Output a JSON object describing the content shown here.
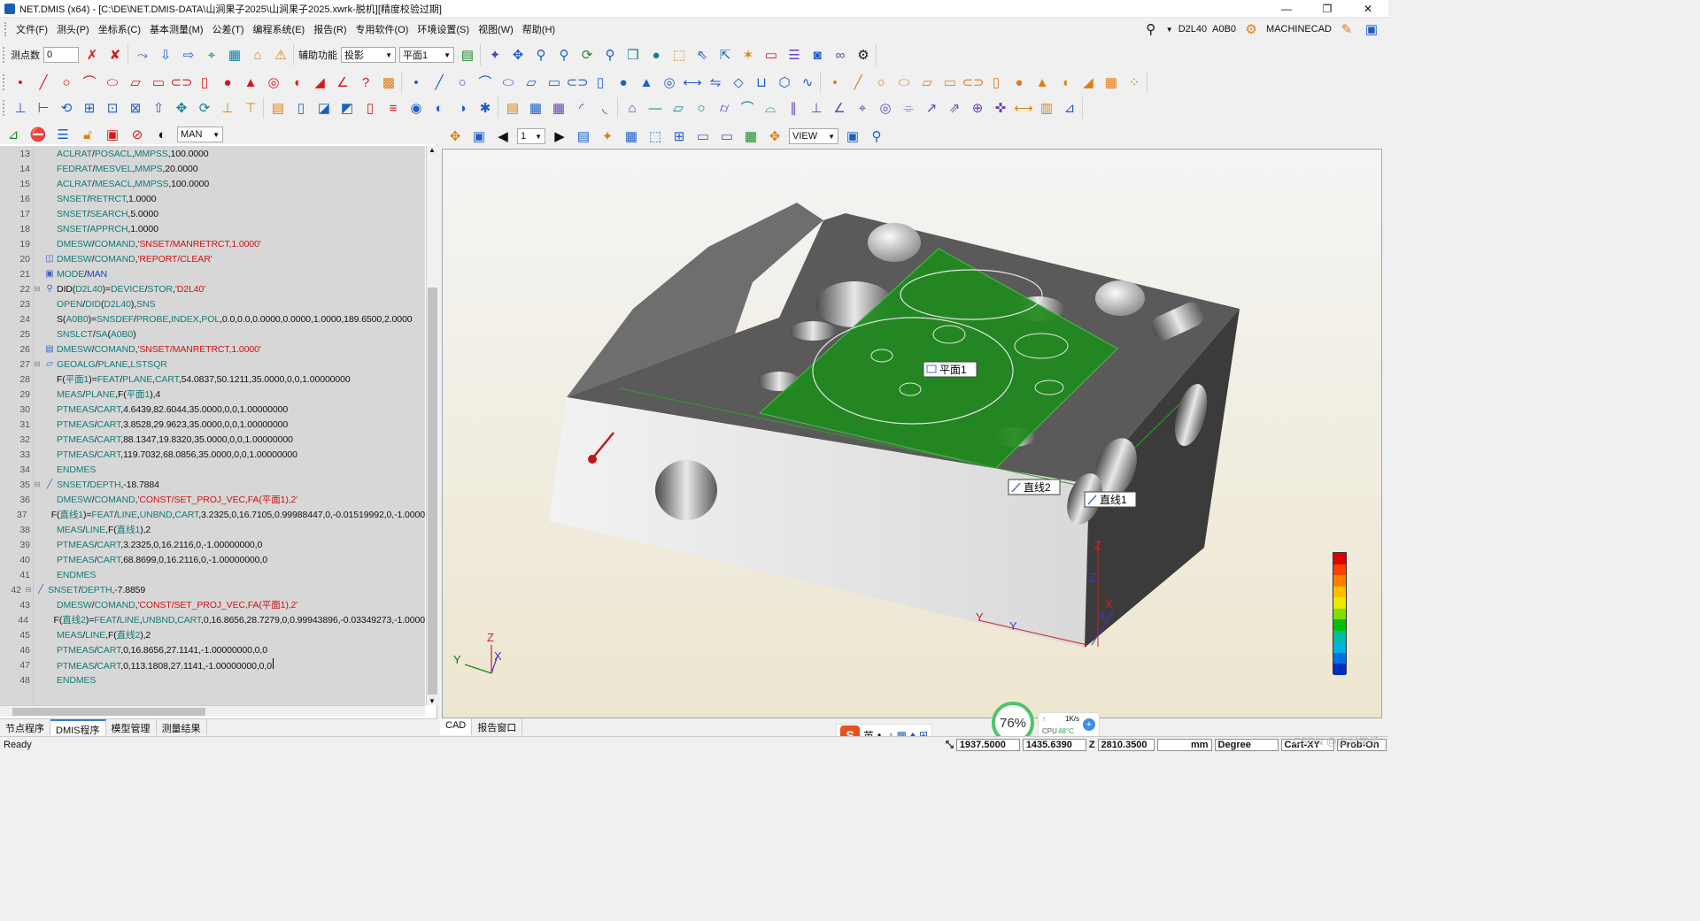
{
  "window": {
    "title": "NET.DMIS (x64) - [C:\\DE\\NET.DMIS-DATA\\山涧果子2025\\山涧果子2025.xwrk-脱机][精度校验过期]",
    "controls": [
      "—",
      "❐",
      "✕"
    ]
  },
  "menu": {
    "items": [
      "文件(F)",
      "测头(P)",
      "坐标系(C)",
      "基本测量(M)",
      "公差(T)",
      "编程系统(E)",
      "报告(R)",
      "专用软件(O)",
      "环境设置(S)",
      "视图(W)",
      "帮助(H)"
    ],
    "probe_label": "D2L40",
    "tip_label": "A0B0",
    "machine_label": "MACHINECAD"
  },
  "toolbar1": {
    "points_label": "测点数",
    "points_value": "0",
    "aux_label": "辅助功能",
    "aux_value": "投影",
    "plane_value": "平面1"
  },
  "left_toolbar": {
    "mode_value": "MAN"
  },
  "code_lines": [
    {
      "n": "13",
      "segs": [
        [
          "kw",
          "ACLRAT"
        ],
        [
          "nm",
          "/"
        ],
        [
          "kw",
          "POSACL"
        ],
        [
          "nm",
          ","
        ],
        [
          "kw",
          "MMPSS"
        ],
        [
          "nm",
          ",100.0000"
        ]
      ]
    },
    {
      "n": "14",
      "segs": [
        [
          "kw",
          "FEDRAT"
        ],
        [
          "nm",
          "/"
        ],
        [
          "kw",
          "MESVEL"
        ],
        [
          "nm",
          ","
        ],
        [
          "kw",
          "MMPS"
        ],
        [
          "nm",
          ",20.0000"
        ]
      ]
    },
    {
      "n": "15",
      "segs": [
        [
          "kw",
          "ACLRAT"
        ],
        [
          "nm",
          "/"
        ],
        [
          "kw",
          "MESACL"
        ],
        [
          "nm",
          ","
        ],
        [
          "kw",
          "MMPSS"
        ],
        [
          "nm",
          ",100.0000"
        ]
      ]
    },
    {
      "n": "16",
      "segs": [
        [
          "kw",
          "SNSET"
        ],
        [
          "nm",
          "/"
        ],
        [
          "kw",
          "RETRCT"
        ],
        [
          "nm",
          ",1.0000"
        ]
      ]
    },
    {
      "n": "17",
      "segs": [
        [
          "kw",
          "SNSET"
        ],
        [
          "nm",
          "/"
        ],
        [
          "kw",
          "SEARCH"
        ],
        [
          "nm",
          ",5.0000"
        ]
      ]
    },
    {
      "n": "18",
      "segs": [
        [
          "kw",
          "SNSET"
        ],
        [
          "nm",
          "/"
        ],
        [
          "kw",
          "APPRCH"
        ],
        [
          "nm",
          ",1.0000"
        ]
      ]
    },
    {
      "n": "19",
      "segs": [
        [
          "kw",
          "DMESW"
        ],
        [
          "nm",
          "/"
        ],
        [
          "kw",
          "COMAND"
        ],
        [
          "nm",
          ","
        ],
        [
          "str",
          "'SNSET/MANRETRCT,1.0000'"
        ]
      ]
    },
    {
      "n": "20",
      "segs": [
        [
          "kw",
          "DMESW"
        ],
        [
          "nm",
          "/"
        ],
        [
          "kw",
          "COMAND"
        ],
        [
          "nm",
          ","
        ],
        [
          "str",
          "'REPORT/CLEAR'"
        ]
      ]
    },
    {
      "n": "21",
      "segs": [
        [
          "kw",
          "MODE"
        ],
        [
          "nm",
          "/"
        ],
        [
          "blu",
          "MAN"
        ]
      ]
    },
    {
      "n": "22",
      "fold": "⊟",
      "segs": [
        [
          "nm",
          "DID("
        ],
        [
          "kw",
          "D2L40"
        ],
        [
          "nm",
          ")="
        ],
        [
          "kw",
          "DEVICE"
        ],
        [
          "nm",
          "/"
        ],
        [
          "kw",
          "STOR"
        ],
        [
          "nm",
          ","
        ],
        [
          "str",
          "'D2L40'"
        ]
      ]
    },
    {
      "n": "23",
      "segs": [
        [
          "kw",
          "OPEN"
        ],
        [
          "nm",
          "/"
        ],
        [
          "kw",
          "DID"
        ],
        [
          "nm",
          "("
        ],
        [
          "kw",
          "D2L40"
        ],
        [
          "nm",
          "),"
        ],
        [
          "kw",
          "SNS"
        ]
      ]
    },
    {
      "n": "24",
      "segs": [
        [
          "nm",
          "S("
        ],
        [
          "kw",
          "A0B0"
        ],
        [
          "nm",
          ")="
        ],
        [
          "kw",
          "SNSDEF"
        ],
        [
          "nm",
          "/"
        ],
        [
          "kw",
          "PROBE"
        ],
        [
          "nm",
          ","
        ],
        [
          "kw",
          "INDEX"
        ],
        [
          "nm",
          ","
        ],
        [
          "kw",
          "POL"
        ],
        [
          "nm",
          ",0.0,0.0,0.0000,0.0000,1.0000,189.6500,2.0000"
        ]
      ]
    },
    {
      "n": "25",
      "segs": [
        [
          "kw",
          "SNSLCT"
        ],
        [
          "nm",
          "/"
        ],
        [
          "kw",
          "SA"
        ],
        [
          "nm",
          "("
        ],
        [
          "kw",
          "A0B0"
        ],
        [
          "nm",
          ")"
        ]
      ]
    },
    {
      "n": "26",
      "segs": [
        [
          "kw",
          "DMESW"
        ],
        [
          "nm",
          "/"
        ],
        [
          "kw",
          "COMAND"
        ],
        [
          "nm",
          ","
        ],
        [
          "str",
          "'SNSET/MANRETRCT,1.0000'"
        ]
      ]
    },
    {
      "n": "27",
      "fold": "⊟",
      "segs": [
        [
          "kw",
          "GEOALG"
        ],
        [
          "nm",
          "/"
        ],
        [
          "kw",
          "PLANE"
        ],
        [
          "nm",
          ","
        ],
        [
          "kw",
          "LSTSQR"
        ]
      ]
    },
    {
      "n": "28",
      "segs": [
        [
          "nm",
          "F("
        ],
        [
          "kw",
          "平面1"
        ],
        [
          "nm",
          ")="
        ],
        [
          "kw",
          "FEAT"
        ],
        [
          "nm",
          "/"
        ],
        [
          "kw",
          "PLANE"
        ],
        [
          "nm",
          ","
        ],
        [
          "kw",
          "CART"
        ],
        [
          "nm",
          ",54.0837,50.1211,35.0000,0,0,1.00000000"
        ]
      ]
    },
    {
      "n": "29",
      "segs": [
        [
          "kw",
          "MEAS"
        ],
        [
          "nm",
          "/"
        ],
        [
          "kw",
          "PLANE"
        ],
        [
          "nm",
          ",F("
        ],
        [
          "kw",
          "平面1"
        ],
        [
          "nm",
          "),4"
        ]
      ]
    },
    {
      "n": "30",
      "segs": [
        [
          "kw",
          "PTMEAS"
        ],
        [
          "nm",
          "/"
        ],
        [
          "kw",
          "CART"
        ],
        [
          "nm",
          ",4.6439,82.6044,35.0000,0,0,1.00000000"
        ]
      ]
    },
    {
      "n": "31",
      "segs": [
        [
          "kw",
          "PTMEAS"
        ],
        [
          "nm",
          "/"
        ],
        [
          "kw",
          "CART"
        ],
        [
          "nm",
          ",3.8528,29.9623,35.0000,0,0,1.00000000"
        ]
      ]
    },
    {
      "n": "32",
      "segs": [
        [
          "kw",
          "PTMEAS"
        ],
        [
          "nm",
          "/"
        ],
        [
          "kw",
          "CART"
        ],
        [
          "nm",
          ",88.1347,19.8320,35.0000,0,0,1.00000000"
        ]
      ]
    },
    {
      "n": "33",
      "segs": [
        [
          "kw",
          "PTMEAS"
        ],
        [
          "nm",
          "/"
        ],
        [
          "kw",
          "CART"
        ],
        [
          "nm",
          ",119.7032,68.0856,35.0000,0,0,1.00000000"
        ]
      ]
    },
    {
      "n": "34",
      "segs": [
        [
          "kw",
          "ENDMES"
        ]
      ]
    },
    {
      "n": "35",
      "fold": "⊟",
      "segs": [
        [
          "kw",
          "SNSET"
        ],
        [
          "nm",
          "/"
        ],
        [
          "kw",
          "DEPTH"
        ],
        [
          "nm",
          ",-18.7884"
        ]
      ]
    },
    {
      "n": "36",
      "segs": [
        [
          "kw",
          "DMESW"
        ],
        [
          "nm",
          "/"
        ],
        [
          "kw",
          "COMAND"
        ],
        [
          "nm",
          ","
        ],
        [
          "str",
          "'CONST/SET_PROJ_VEC,FA(平面1),2'"
        ]
      ]
    },
    {
      "n": "37",
      "segs": [
        [
          "nm",
          "F("
        ],
        [
          "kw",
          "直线1"
        ],
        [
          "nm",
          ")="
        ],
        [
          "kw",
          "FEAT"
        ],
        [
          "nm",
          "/"
        ],
        [
          "kw",
          "LINE"
        ],
        [
          "nm",
          ","
        ],
        [
          "kw",
          "UNBND"
        ],
        [
          "nm",
          ","
        ],
        [
          "kw",
          "CART"
        ],
        [
          "nm",
          ",3.2325,0,16.7105,0.99988447,0,-0.01519992,0,-1.0000"
        ]
      ]
    },
    {
      "n": "38",
      "segs": [
        [
          "kw",
          "MEAS"
        ],
        [
          "nm",
          "/"
        ],
        [
          "kw",
          "LINE"
        ],
        [
          "nm",
          ",F("
        ],
        [
          "kw",
          "直线1"
        ],
        [
          "nm",
          "),2"
        ]
      ]
    },
    {
      "n": "39",
      "segs": [
        [
          "kw",
          "PTMEAS"
        ],
        [
          "nm",
          "/"
        ],
        [
          "kw",
          "CART"
        ],
        [
          "nm",
          ",3.2325,0,16.2116,0,-1.00000000,0"
        ]
      ]
    },
    {
      "n": "40",
      "segs": [
        [
          "kw",
          "PTMEAS"
        ],
        [
          "nm",
          "/"
        ],
        [
          "kw",
          "CART"
        ],
        [
          "nm",
          ",68.8699,0,16.2116,0,-1.00000000,0"
        ]
      ]
    },
    {
      "n": "41",
      "segs": [
        [
          "kw",
          "ENDMES"
        ]
      ]
    },
    {
      "n": "42",
      "fold": "⊟",
      "segs": [
        [
          "kw",
          "SNSET"
        ],
        [
          "nm",
          "/"
        ],
        [
          "kw",
          "DEPTH"
        ],
        [
          "nm",
          ",-7.8859"
        ]
      ]
    },
    {
      "n": "43",
      "segs": [
        [
          "kw",
          "DMESW"
        ],
        [
          "nm",
          "/"
        ],
        [
          "kw",
          "COMAND"
        ],
        [
          "nm",
          ","
        ],
        [
          "str",
          "'CONST/SET_PROJ_VEC,FA(平面1),2'"
        ]
      ]
    },
    {
      "n": "44",
      "segs": [
        [
          "nm",
          "F("
        ],
        [
          "kw",
          "直线2"
        ],
        [
          "nm",
          ")="
        ],
        [
          "kw",
          "FEAT"
        ],
        [
          "nm",
          "/"
        ],
        [
          "kw",
          "LINE"
        ],
        [
          "nm",
          ","
        ],
        [
          "kw",
          "UNBND"
        ],
        [
          "nm",
          ","
        ],
        [
          "kw",
          "CART"
        ],
        [
          "nm",
          ",0,16.8656,28.7279,0,0.99943896,-0.03349273,-1.0000"
        ]
      ]
    },
    {
      "n": "45",
      "segs": [
        [
          "kw",
          "MEAS"
        ],
        [
          "nm",
          "/"
        ],
        [
          "kw",
          "LINE"
        ],
        [
          "nm",
          ",F("
        ],
        [
          "kw",
          "直线2"
        ],
        [
          "nm",
          "),2"
        ]
      ]
    },
    {
      "n": "46",
      "segs": [
        [
          "kw",
          "PTMEAS"
        ],
        [
          "nm",
          "/"
        ],
        [
          "kw",
          "CART"
        ],
        [
          "nm",
          ",0,16.8656,27.1141,-1.00000000,0,0"
        ]
      ]
    },
    {
      "n": "47",
      "segs": [
        [
          "kw",
          "PTMEAS"
        ],
        [
          "nm",
          "/"
        ],
        [
          "kw",
          "CART"
        ],
        [
          "nm",
          ",0,113.1808,27.1141,-1.00000000,0,0"
        ]
      ]
    },
    {
      "n": "48",
      "segs": [
        [
          "kw",
          "ENDMES"
        ]
      ]
    }
  ],
  "left_tabs": [
    "节点程序",
    "DMIS程序",
    "模型管理",
    "测量结果"
  ],
  "right_toolbar": {
    "page_value": "1",
    "view_value": "VIEW"
  },
  "viewport": {
    "feature_labels": [
      "平面1",
      "直线2",
      "直线1"
    ],
    "axis_labels": {
      "z": "Z",
      "y": "Y",
      "x": "X"
    },
    "plane_color": "#1e8a1e",
    "part_color": "#5a5a5a"
  },
  "right_tabs": [
    "CAD",
    "报告窗口"
  ],
  "status": {
    "ready": "Ready",
    "x": "1937.5000",
    "y": "1435.6390",
    "z_label": "Z",
    "z": "2810.3500",
    "unit": "mm",
    "angle_unit": "Degree",
    "coord_sys": "Cart-XY",
    "probe_state": "Prob-On"
  },
  "tray": {
    "ime_lang": "英",
    "cpu_percent": "76%",
    "net_speed": "1K/s",
    "cpu_label": "CPU",
    "cpu_temp": "48°C"
  },
  "watermark": "CSDN @山涧果子"
}
